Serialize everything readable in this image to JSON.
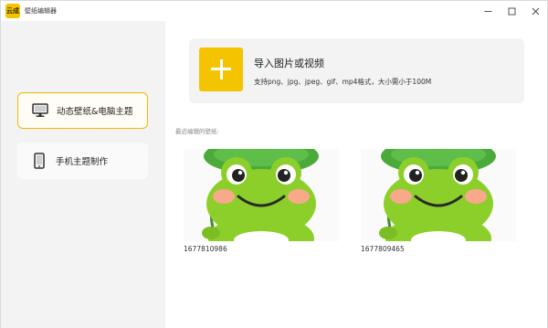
{
  "app": {
    "logo_text": "云成",
    "title": "壁纸编辑器"
  },
  "window_controls": [
    "minimize-icon",
    "maximize-icon",
    "close-icon"
  ],
  "sidebar": {
    "items": [
      {
        "label": "动态壁纸&电脑主题",
        "icon": "monitor-icon",
        "active": true
      },
      {
        "label": "手机主题制作",
        "icon": "phone-icon",
        "active": false
      }
    ]
  },
  "import": {
    "title": "导入图片或视频",
    "subtitle": "支持png、jpg、jpeg、gif、mp4格式，大小需小于100M",
    "icon": "plus-icon"
  },
  "recent": {
    "label": "最近编辑的壁纸:",
    "items": [
      {
        "name": "1677810986"
      },
      {
        "name": "1677809465"
      }
    ]
  },
  "colors": {
    "accent": "#f5c400",
    "frog_green": "#8dcf2a",
    "leaf_green": "#4caa3a"
  }
}
